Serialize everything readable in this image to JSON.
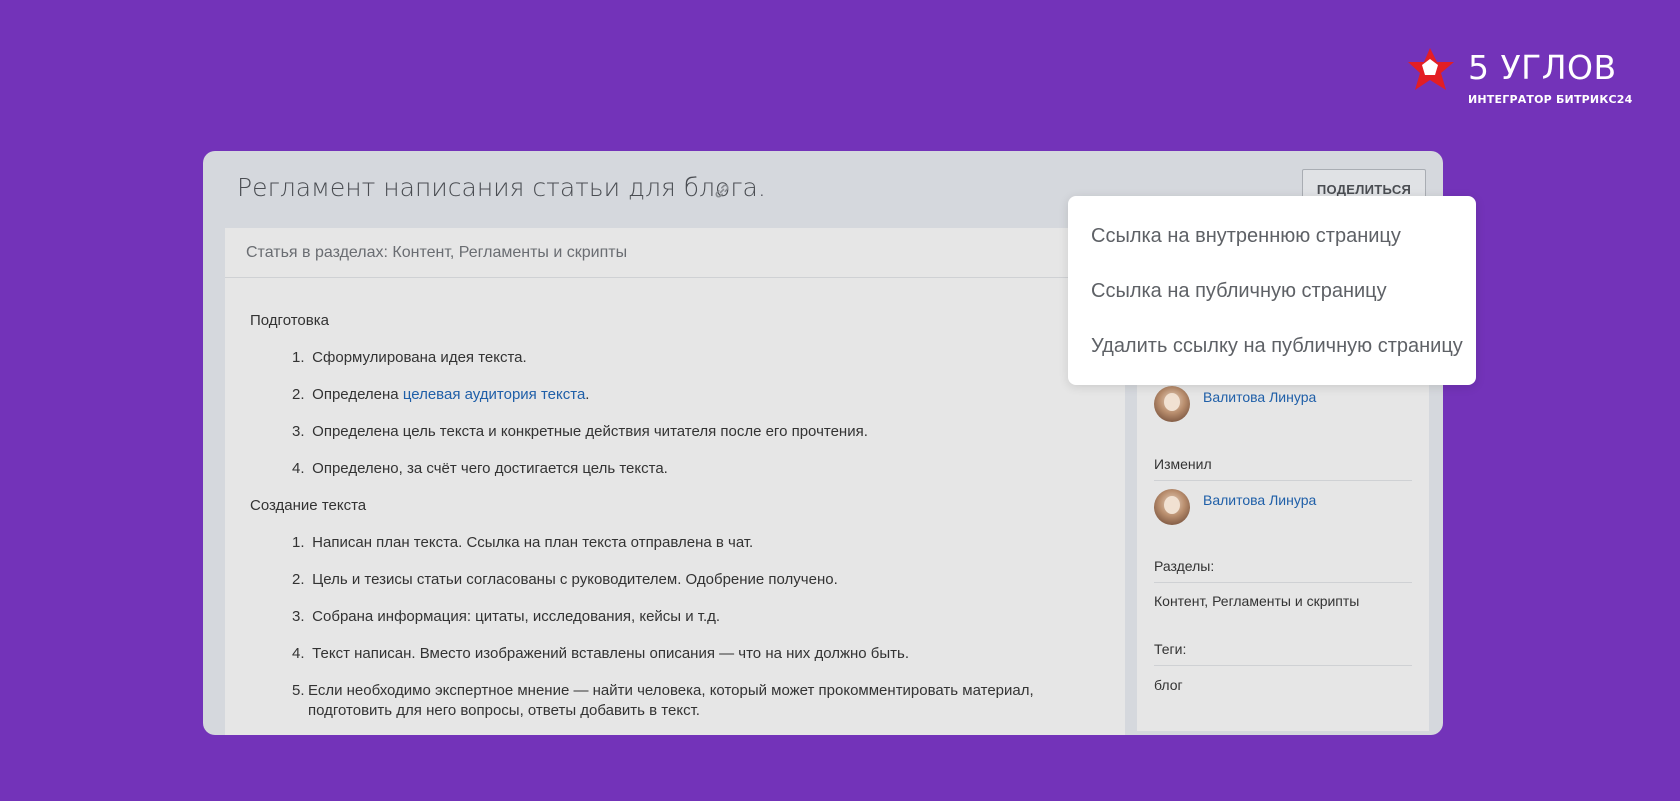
{
  "brand": {
    "name": "5 УГЛОВ",
    "subtitle": "ИНТЕГРАТОР БИТРИКС24",
    "colors": {
      "star": "#e31e24",
      "text": "#ffffff",
      "background": "#7333b9"
    }
  },
  "page": {
    "title": "Регламент написания статьи для блога.",
    "share_label": "ПОДЕЛИТЬСЯ",
    "sections_line": "Статья в разделах: Контент, Регламенты и скрипты"
  },
  "article": {
    "prep_heading": "Подготовка",
    "prep_items": [
      {
        "num": "1.",
        "text": "Сформулирована идея текста."
      },
      {
        "num": "2.",
        "pre": "Определена ",
        "link": "целевая аудитория текста",
        "post": "."
      },
      {
        "num": "3.",
        "text": "Определена цель текста и конкретные действия читателя после его прочтения."
      },
      {
        "num": "4.",
        "text": "Определено, за счёт чего достигается цель текста."
      }
    ],
    "create_heading": "Создание текста",
    "create_items": [
      {
        "num": "1.",
        "text": "Написан план текста. Ссылка на план текста отправлена в чат."
      },
      {
        "num": "2.",
        "text": "Цель и тезисы статьи согласованы с руководителем. Одобрение получено."
      },
      {
        "num": "3.",
        "text": "Собрана информация: цитаты, исследования, кейсы и т.д."
      },
      {
        "num": "4.",
        "text": "Текст написан. Вместо изображений вставлены описания — что на них должно быть."
      },
      {
        "num": "5.",
        "text": "Если необходимо экспертное мнение — найти человека, который может прокомментировать материал, подготовить для него вопросы, ответы добавить в текст."
      }
    ]
  },
  "sidebar": {
    "created_by": "Валитова Линура",
    "modified_label": "Изменил",
    "modified_by": "Валитова Линура",
    "sections_label": "Разделы:",
    "sections_value": "Контент, Регламенты и скрипты",
    "tags_label": "Теги:",
    "tags_value": "блог"
  },
  "dropdown": {
    "items": [
      "Ссылка на внутреннюю страницу",
      "Ссылка на публичную страницу",
      "Удалить ссылку на публичную страницу"
    ]
  }
}
